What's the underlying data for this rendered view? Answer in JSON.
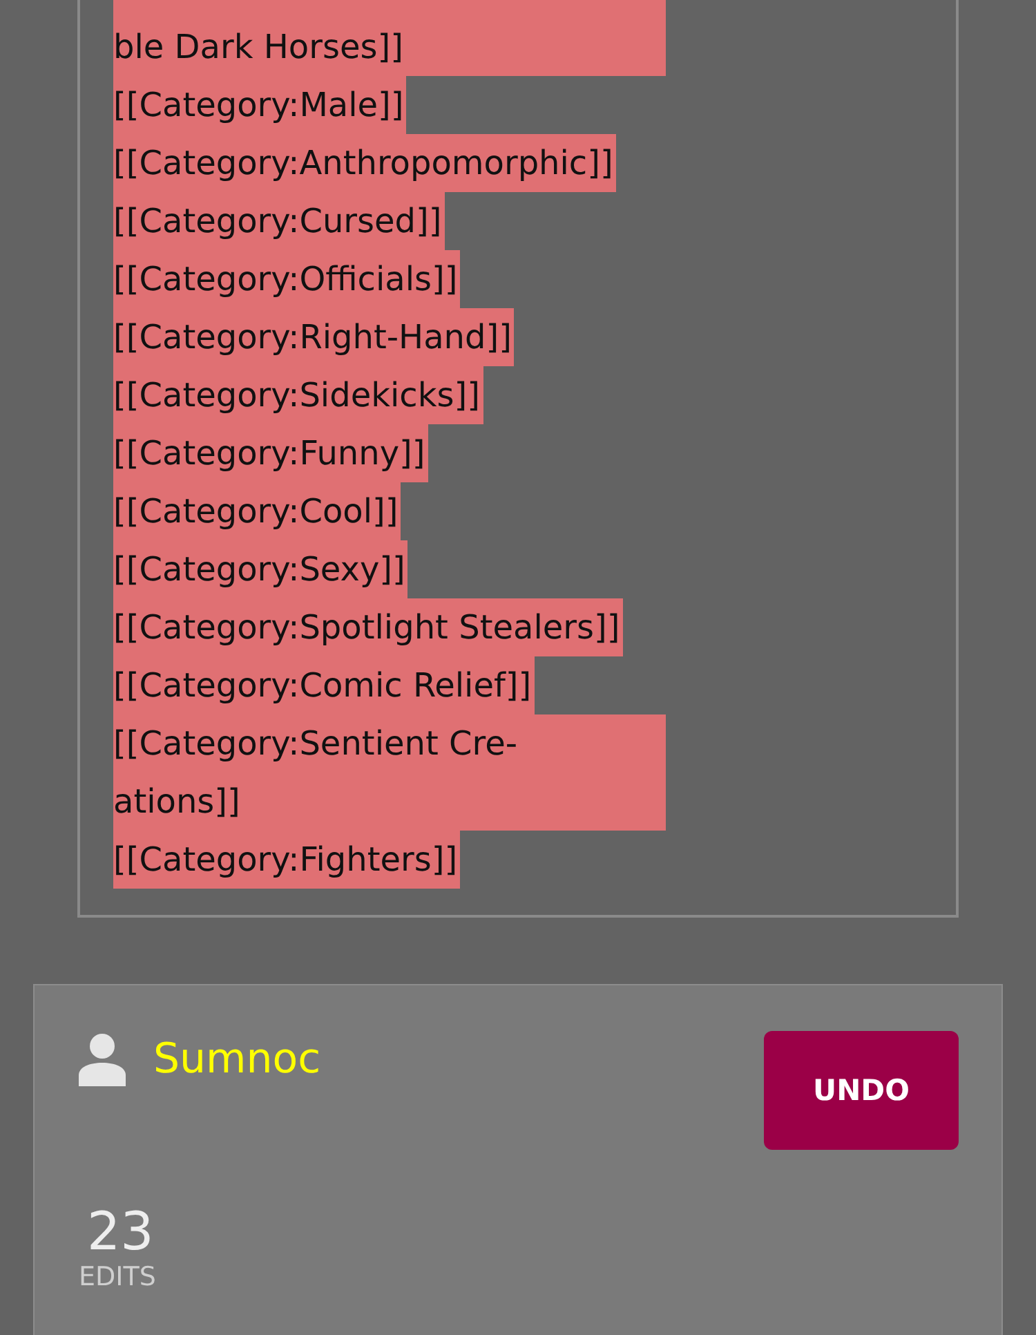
{
  "diff_lines": [
    {
      "lines": [
        "ble Dark Horses]]"
      ]
    },
    {
      "lines": [
        "[[Category:Male]]"
      ]
    },
    {
      "lines": [
        "[[Category:Anthropomorphic]]"
      ]
    },
    {
      "lines": [
        "[[Category:Cursed]]"
      ]
    },
    {
      "lines": [
        "[[Category:Officials]]"
      ]
    },
    {
      "lines": [
        "[[Category:Right-Hand]]"
      ]
    },
    {
      "lines": [
        "[[Category:Sidekicks]]"
      ]
    },
    {
      "lines": [
        "[[Category:Funny]]"
      ]
    },
    {
      "lines": [
        "[[Category:Cool]]"
      ]
    },
    {
      "lines": [
        "[[Category:Sexy]]"
      ]
    },
    {
      "lines": [
        "[[Category:Spotlight Stealers]]"
      ]
    },
    {
      "lines": [
        "[[Category:Comic Relief]]"
      ]
    },
    {
      "lines": [
        "[[Category:Sentient Cre-",
        "ations]]"
      ]
    },
    {
      "lines": [
        "[[Category:Fighters]]"
      ]
    }
  ],
  "editor": {
    "username": "Sumnoc",
    "button": "UNDO",
    "edit_count": "23",
    "edit_label": "EDITS"
  }
}
